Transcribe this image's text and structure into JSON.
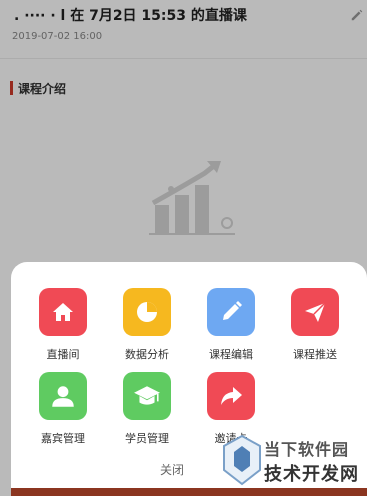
{
  "header": {
    "title": ". ···· · l 在 7月2日 15:53 的直播课",
    "date": "2019-07-02 16:00"
  },
  "section": {
    "title": "课程介绍"
  },
  "menu": {
    "items": [
      {
        "label": "直播间",
        "icon": "home-icon",
        "color": "#f04a55"
      },
      {
        "label": "数据分析",
        "icon": "pie-chart-icon",
        "color": "#f6b81f"
      },
      {
        "label": "课程编辑",
        "icon": "pencil-icon",
        "color": "#6ea8f2"
      },
      {
        "label": "课程推送",
        "icon": "send-icon",
        "color": "#f04a55"
      },
      {
        "label": "嘉宾管理",
        "icon": "user-icon",
        "color": "#5fcb61"
      },
      {
        "label": "学员管理",
        "icon": "graduation-cap-icon",
        "color": "#5fcb61"
      },
      {
        "label": "邀请卡",
        "icon": "share-arrow-icon",
        "color": "#f04a55"
      }
    ],
    "close_label": "关闭"
  },
  "watermark": {
    "line1": "当下软件园",
    "line2": "技术开发网"
  }
}
